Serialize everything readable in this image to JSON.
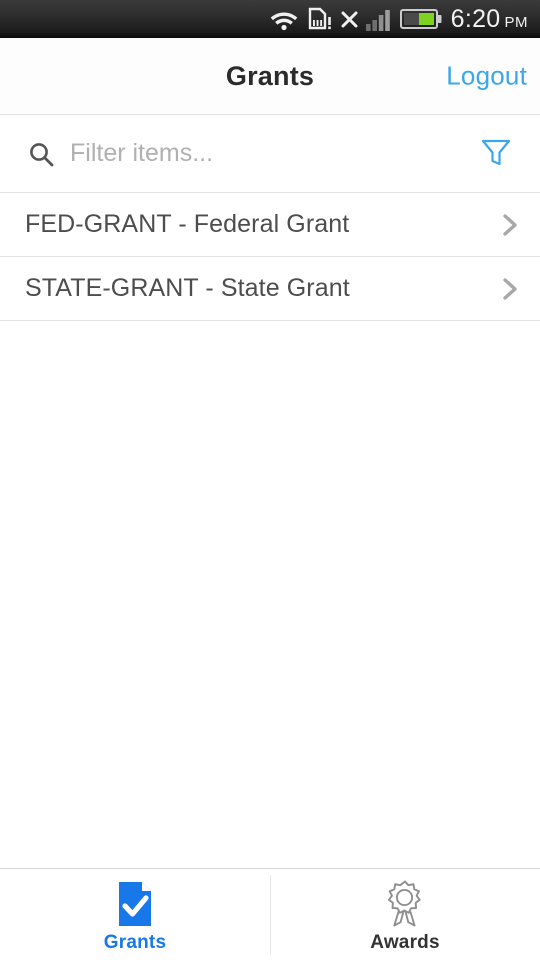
{
  "status_bar": {
    "time": "6:20",
    "ampm": "PM",
    "icons": [
      "wifi-icon",
      "sdcard-warning-icon",
      "no-service-x-icon",
      "signal-bars-icon",
      "battery-icon"
    ],
    "battery_level_percent": 55
  },
  "header": {
    "title": "Grants",
    "logout_label": "Logout",
    "accent_color": "#3ba7e8"
  },
  "filter_bar": {
    "placeholder": "Filter items...",
    "value": "",
    "search_icon": "search-icon",
    "funnel_icon": "funnel-icon",
    "funnel_color": "#3ba7e8"
  },
  "list": {
    "items": [
      {
        "label": "FED-GRANT - Federal Grant",
        "chevron": "chevron-right-icon"
      },
      {
        "label": "STATE-GRANT - State Grant",
        "chevron": "chevron-right-icon"
      }
    ]
  },
  "tab_bar": {
    "active_color": "#1878ea",
    "inactive_color": "#333333",
    "tabs": [
      {
        "label": "Grants",
        "icon": "document-check-icon",
        "active": true
      },
      {
        "label": "Awards",
        "icon": "award-ribbon-icon",
        "active": false
      }
    ]
  }
}
